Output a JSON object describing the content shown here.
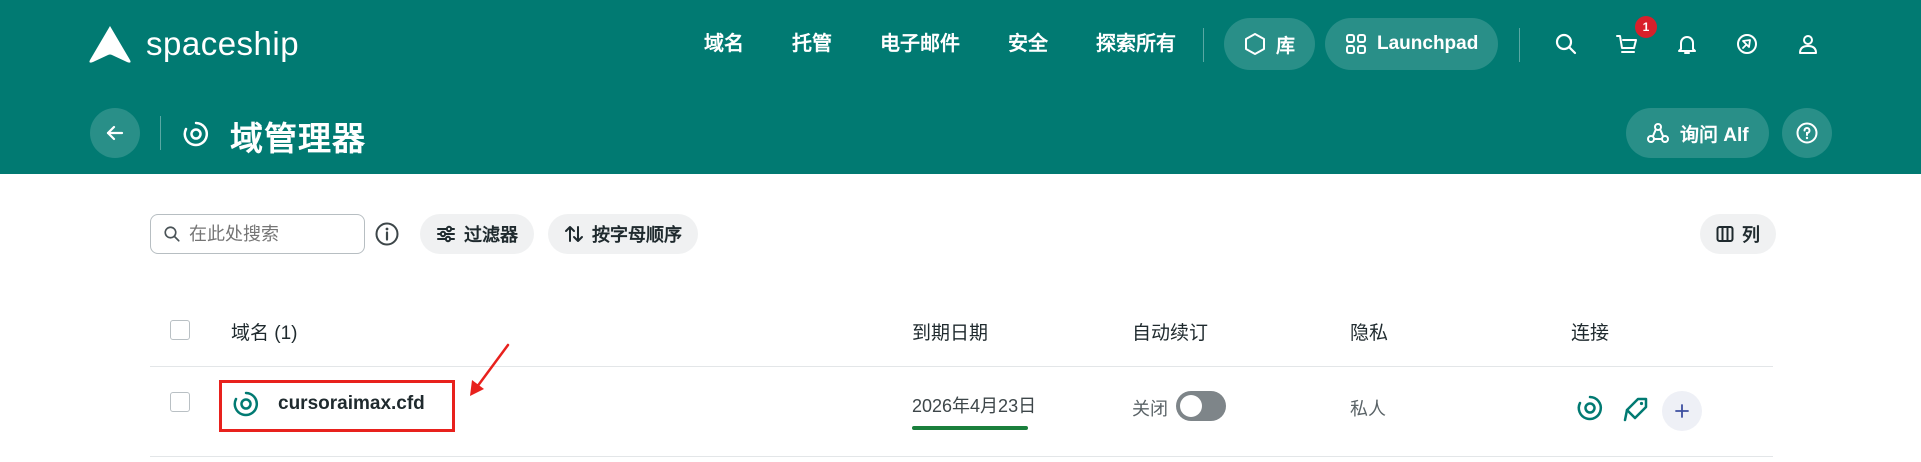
{
  "header": {
    "brand": "spaceship",
    "nav": [
      "域名",
      "托管",
      "电子邮件",
      "安全",
      "探索所有"
    ],
    "library_label": "库",
    "launchpad_label": "Launchpad",
    "cart_badge": "1",
    "page_title": "域管理器",
    "ask_label": "询问 Alf",
    "colors": {
      "header_bg": "#017a72",
      "badge": "#d8202b"
    }
  },
  "toolbar": {
    "search_placeholder": "在此处搜索",
    "filter_label": "过滤器",
    "sort_label": "按字母顺序",
    "columns_label": "列"
  },
  "table": {
    "headers": {
      "domain": "域名 (1)",
      "expiry": "到期日期",
      "autorenew": "自动续订",
      "privacy": "隐私",
      "connect": "连接"
    },
    "rows": [
      {
        "domain": "cursoraimax.cfd",
        "expiry": "2026年4月23日",
        "autorenew_label": "关闭",
        "autorenew_on": false,
        "privacy": "私人"
      }
    ]
  },
  "icons": [
    "logo-icon",
    "hexagon-icon",
    "grid-icon",
    "search-icon",
    "cart-icon",
    "bell-icon",
    "rocket-icon",
    "user-icon",
    "back-arrow-icon",
    "target-icon",
    "help-icon",
    "info-icon",
    "sliders-icon",
    "sort-icon",
    "columns-icon",
    "alf-icon",
    "domain-icon",
    "tag-icon",
    "plus-icon"
  ]
}
